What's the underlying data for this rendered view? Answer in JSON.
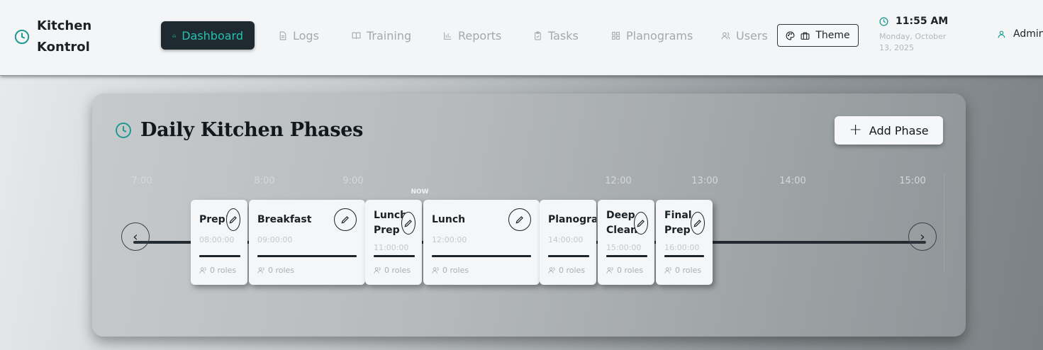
{
  "brand": {
    "name": "Kitchen Kontrol"
  },
  "nav": {
    "items": [
      {
        "label": "Dashboard",
        "icon": "home-icon",
        "active": true
      },
      {
        "label": "Logs",
        "icon": "document-icon"
      },
      {
        "label": "Training",
        "icon": "book-icon"
      },
      {
        "label": "Reports",
        "icon": "bar-chart-icon"
      },
      {
        "label": "Tasks",
        "icon": "clipboard-icon"
      },
      {
        "label": "Planograms",
        "icon": "grid-icon"
      },
      {
        "label": "Users",
        "icon": "users-icon"
      }
    ]
  },
  "theme_button": {
    "label": "Theme"
  },
  "clock": {
    "time": "11:55 AM",
    "date": "Monday, October 13, 2025"
  },
  "user": {
    "name": "Admin"
  },
  "card": {
    "title": "Daily Kitchen Phases",
    "add_label": "Add Phase"
  },
  "timeline": {
    "ticks": [
      "7:00",
      "8:00",
      "9:00",
      "12:00",
      "13:00",
      "14:00",
      "15:00"
    ],
    "now_label": "NOW",
    "phases": [
      {
        "name": "Prep1",
        "time": "08:00:00",
        "roles": "0 roles"
      },
      {
        "name": "Breakfast",
        "time": "09:00:00",
        "roles": "0 roles"
      },
      {
        "name": "Lunch Prep",
        "time": "11:00:00",
        "roles": "0 roles"
      },
      {
        "name": "Lunch",
        "time": "12:00:00",
        "roles": "0 roles"
      },
      {
        "name": "Planogram",
        "time": "14:00:00",
        "roles": "0 roles"
      },
      {
        "name": "Deep Clean",
        "time": "15:00:00",
        "roles": "0 roles"
      },
      {
        "name": "Final Prep",
        "time": "16:00:00",
        "roles": "0 roles"
      }
    ]
  },
  "colors": {
    "accent": "#1f9a91",
    "active_nav_bg": "#1e2a30",
    "active_nav_text": "#27c0b0"
  }
}
